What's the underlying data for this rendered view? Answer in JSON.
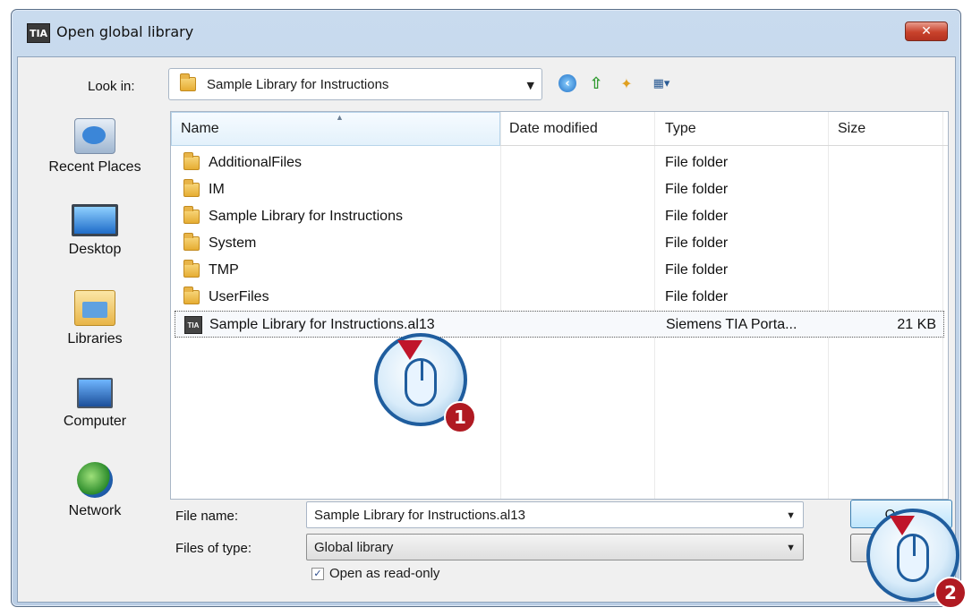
{
  "window": {
    "title": "Open global library",
    "app_icon_text": "TIA",
    "close_label": "✕"
  },
  "toolbar": {
    "look_in_label": "Look in:",
    "look_in_value": "Sample Library for Instructions"
  },
  "places": [
    {
      "label": "Recent Places",
      "icon": "recent-places-icon"
    },
    {
      "label": "Desktop",
      "icon": "desktop-icon"
    },
    {
      "label": "Libraries",
      "icon": "libraries-icon"
    },
    {
      "label": "Computer",
      "icon": "computer-icon"
    },
    {
      "label": "Network",
      "icon": "network-icon"
    }
  ],
  "columns": [
    "Name",
    "Date modified",
    "Type",
    "Size"
  ],
  "files": [
    {
      "name": "AdditionalFiles",
      "date": "",
      "type": "File folder",
      "size": ""
    },
    {
      "name": "IM",
      "date": "",
      "type": "File folder",
      "size": ""
    },
    {
      "name": "Sample Library for Instructions",
      "date": "",
      "type": "File folder",
      "size": ""
    },
    {
      "name": "System",
      "date": "",
      "type": "File folder",
      "size": ""
    },
    {
      "name": "TMP",
      "date": "",
      "type": "File folder",
      "size": ""
    },
    {
      "name": "UserFiles",
      "date": "",
      "type": "File folder",
      "size": ""
    },
    {
      "name": "Sample Library for Instructions.al13",
      "date": "",
      "type": "Siemens TIA Porta...",
      "size": "21 KB"
    }
  ],
  "form": {
    "file_name_label": "File name:",
    "file_name_value": "Sample Library for Instructions.al13",
    "file_type_label": "Files of type:",
    "file_type_value": "Global library",
    "readonly_label": "Open as read-only",
    "readonly_checked": true
  },
  "buttons": {
    "open": "Open",
    "cancel": ""
  },
  "callouts": [
    "1",
    "2"
  ]
}
